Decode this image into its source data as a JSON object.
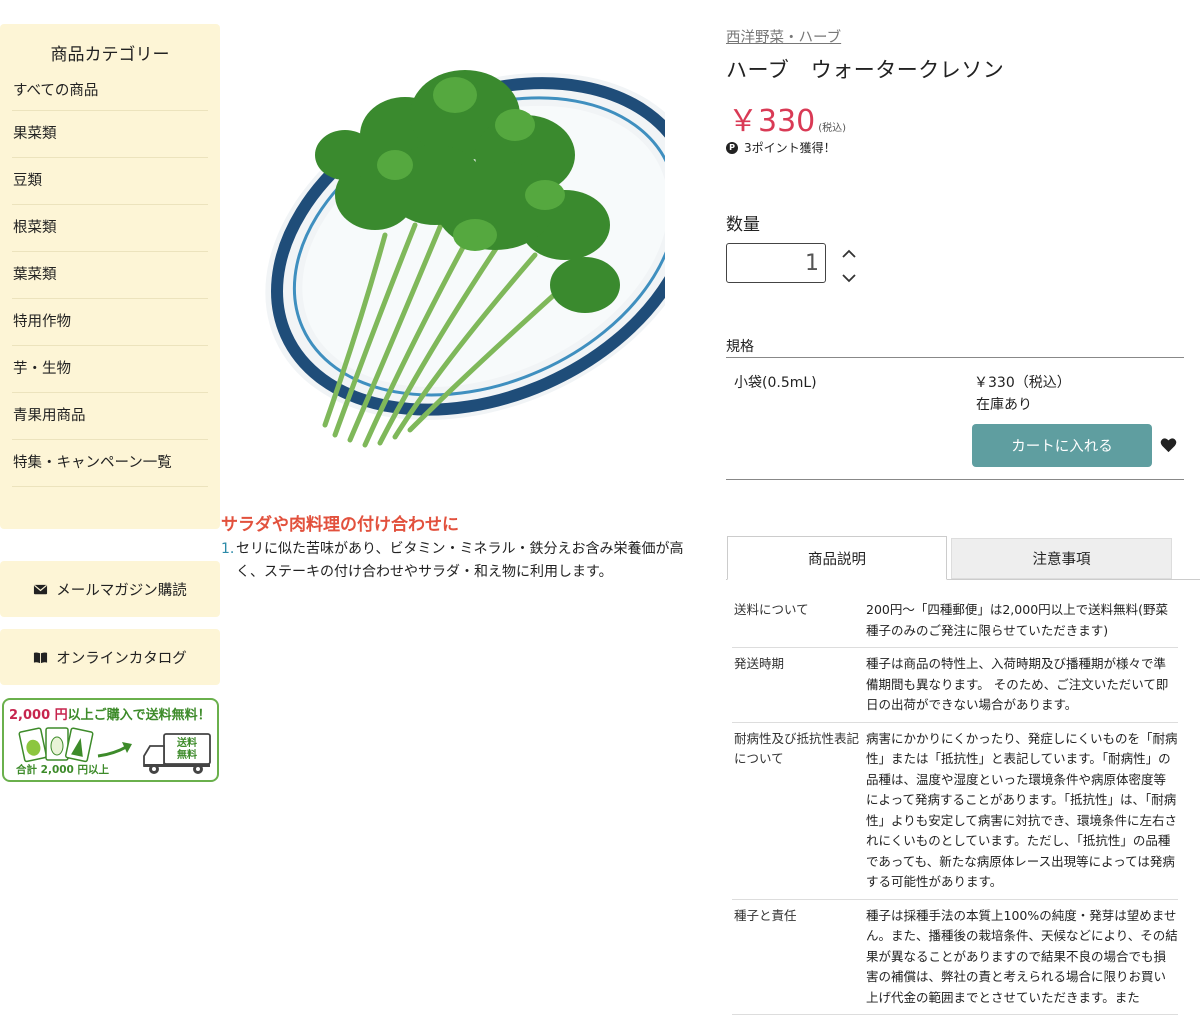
{
  "sidebar": {
    "heading": "商品カテゴリー",
    "categories": [
      "すべての商品",
      "果菜類",
      "豆類",
      "根菜類",
      "葉菜類",
      "特用作物",
      "芋・生物",
      "青果用商品",
      "特集・キャンペーン一覧"
    ],
    "mail_label": "メールマガジン購読",
    "catalog_label": "オンラインカタログ",
    "banner": {
      "amount": "2,000 円",
      "text": "以上ご購入で送料無料！",
      "sub": "合計 2,000 円以上",
      "truck_label1": "送料",
      "truck_label2": "無料"
    }
  },
  "product": {
    "breadcrumb": "西洋野菜・ハーブ",
    "title": "ハーブ　ウォータークレソン",
    "price": "￥330",
    "tax_note": "(税込)",
    "points": "3ポイント獲得！",
    "quantity_label": "数量",
    "quantity_value": "1",
    "spec_label": "規格",
    "spec_name": "小袋(0.5mL)",
    "spec_price": "￥330（税込）",
    "spec_stock": "在庫あり",
    "cart_label": "カートに入れる"
  },
  "feature": {
    "title": "サラダや肉料理の付け合わせに",
    "items": [
      "セリに似た苦味があり、ビタミン・ミネラル・鉄分えお含み栄養価が高く、ステーキの付け合わせやサラダ・和え物に利用します。"
    ]
  },
  "tabs": [
    "商品説明",
    "注意事項"
  ],
  "notes": [
    {
      "k": "送料について",
      "v": "200円〜「四種郵便」は2,000円以上で送料無料(野菜種子のみのご発注に限らせていただきます)"
    },
    {
      "k": "発送時期",
      "v": "種子は商品の特性上、入荷時期及び播種期が様々で準備期間も異なります。 そのため、ご注文いただいて即日の出荷ができない場合があります。"
    },
    {
      "k": "耐病性及び抵抗性表記について",
      "v": "病害にかかりにくかったり、発症しにくいものを「耐病性」または「抵抗性」と表記しています。「耐病性」の品種は、温度や湿度といった環境条件や病原体密度等によって発病することがあります。「抵抗性」は、「耐病性」よりも安定して病害に対抗でき、環境条件に左右されにくいものとしています。ただし、「抵抗性」の品種であっても、新たな病原体レース出現等によっては発病する可能性があります。"
    },
    {
      "k": "種子と責任",
      "v": "種子は採種手法の本質上100%の純度・発芽は望めません。また、播種後の栽培条件、天候などにより、その結果が異なることがありますので結果不良の場合でも損害の補償は、弊社の責と考えられる場合に限りお買い上げ代金の範囲までとさせていただきます。また"
    }
  ],
  "colors": {
    "accent": "#5f9ea0",
    "price": "#d93a55",
    "feature": "#e2513d",
    "sidebar_bg": "#fdf5d6",
    "banner_green": "#6ab04c"
  }
}
